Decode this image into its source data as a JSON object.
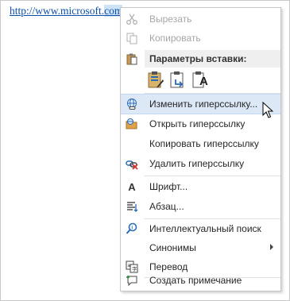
{
  "document": {
    "link_text": "http://www.microsoft.",
    "link_text_selected": "com"
  },
  "context_menu": {
    "items": {
      "cut": {
        "label": "Вырезать",
        "icon": "scissors-icon",
        "enabled": false
      },
      "copy": {
        "label": "Копировать",
        "icon": "copy-icon",
        "enabled": false
      },
      "paste_options": {
        "label": "Параметры вставки:",
        "icon": "clipboard-icon"
      },
      "edit_hyperlink": {
        "label": "Изменить гиперссылку...",
        "icon": "globe-link-icon",
        "highlighted": true
      },
      "open_hyperlink": {
        "label": "Открыть гиперссылку",
        "icon": "open-link-icon"
      },
      "copy_hyperlink": {
        "label": "Копировать гиперссылку"
      },
      "remove_hyperlink": {
        "label": "Удалить гиперссылку",
        "icon": "unlink-icon"
      },
      "font": {
        "label": "Шрифт...",
        "icon": "font-icon"
      },
      "paragraph": {
        "label": "Абзац...",
        "icon": "paragraph-icon"
      },
      "smart_lookup": {
        "label": "Интеллектуальный поиск",
        "icon": "smart-lookup-icon"
      },
      "synonyms": {
        "label": "Синонимы",
        "has_submenu": true
      },
      "translate": {
        "label": "Перевод",
        "icon": "translate-icon"
      },
      "new_comment": {
        "label": "Создать примечание",
        "icon": "comment-icon"
      }
    },
    "paste_buttons": [
      {
        "name": "keep-source-formatting",
        "icon": "paste-keep-formatting-icon"
      },
      {
        "name": "merge-formatting",
        "icon": "paste-merge-formatting-icon"
      },
      {
        "name": "keep-text-only",
        "icon": "paste-text-only-icon",
        "glyph": "A"
      }
    ],
    "colors": {
      "highlight": "#dce8f6",
      "disabled_text": "#a6a6a6",
      "icon_blue": "#2b6cb5",
      "icon_orange": "#e07b2a"
    }
  }
}
